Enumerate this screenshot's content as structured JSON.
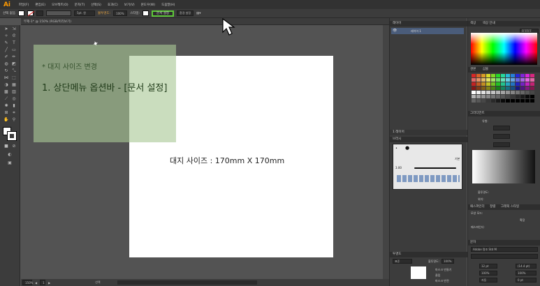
{
  "app": {
    "logo": "Ai"
  },
  "menu": [
    "파일(F)",
    "편집(E)",
    "오브젝트(O)",
    "문자(T)",
    "선택(S)",
    "효과(C)",
    "보기(V)",
    "윈도우(W)",
    "도움말(H)"
  ],
  "control_bar": {
    "selection_label": "선택 없음",
    "stroke_value": "",
    "brush_label": "5pt. 원",
    "opacity_label": "불투명도:",
    "opacity_value": "100%",
    "style_label": "스타일:",
    "doc_setup_button": "문서 설정",
    "prefs_button": "환경 설정"
  },
  "document": {
    "tab_title": "무제-1* @ 150% (RGB/미리보기)",
    "zoom": "150%",
    "page_num": "1",
    "status": "선택"
  },
  "note": {
    "title": "* 대지 사이즈 변경",
    "step": "1.  상단메뉴 옵션바 - [문서 설정]"
  },
  "artboard_text": "대지 사이즈 : 170mm X 170mm",
  "panels": {
    "layers_header": "레이어",
    "layer_name": "레이어 1",
    "layers_footer": "1 레이어",
    "brushes_header": "브러시",
    "brush_basic": "기본",
    "brush_size": "3.00",
    "transparency_header": "투명도",
    "blend_mode": "표준",
    "transparency_opacity_label": "불투명도:",
    "transparency_opacity_value": "100%",
    "make_mask": "마스크 만들기",
    "clip": "클립",
    "invert_mask": "마스크 반전",
    "color_header": "색상",
    "color_guide_header": "색상 안내",
    "color_hex": "FFFFFF",
    "swatches_header": "견본",
    "symbols_header": "심볼",
    "gradient_header": "그라디언트",
    "gradient_type_label": "유형:",
    "gradient_opacity_label": "불투명도:",
    "gradient_position_label": "위치:",
    "pathfinder_header": "패스파인더",
    "align_header": "정렬",
    "appearance_header": "그래픽 스타일",
    "shape_modes_label": "모양 모드:",
    "pathfinder_label": "패스파인더:",
    "expand_label": "확장",
    "char_header": "문자",
    "font_name": "Adobe 명조 Std M",
    "font_size": "12 pt",
    "leading": "(14.4 pt)",
    "tracking": "100%",
    "kerning": "자동",
    "scale": "100%",
    "baseline": "0 pt"
  },
  "colors": {
    "highlight": "#5fc93a",
    "accent": "#ff9a00"
  }
}
